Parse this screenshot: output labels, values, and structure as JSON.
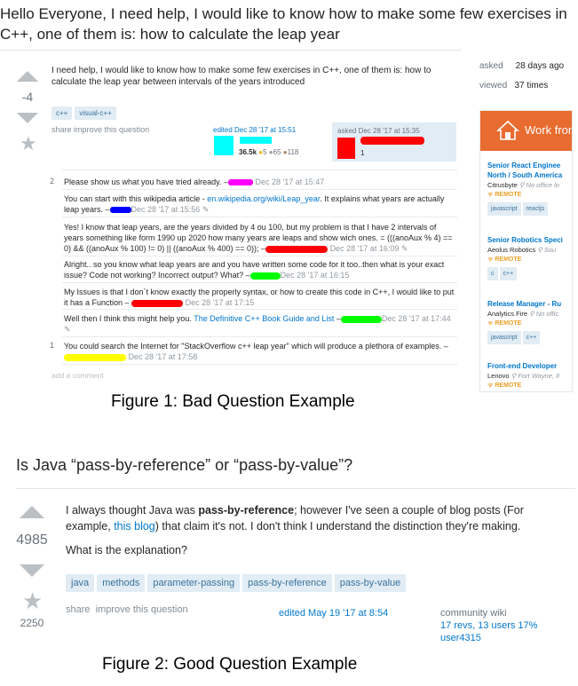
{
  "figure1": {
    "title": "Hello Everyone, I need help, I would like to know how to make some few exercises in C++, one of them is: how to calculate the leap year",
    "score": "-4",
    "body": "I need help, I would like to know how to make some few exercises in C++, one of them is: how to calculate the leap year between intervals of the years introduced",
    "tags": [
      "c++",
      "visual-c++"
    ],
    "share_label": "share",
    "improve_label": "improve this question",
    "edited": "edited Dec 28 '17 at 15:51",
    "editor_rep": "36.5k",
    "editor_badges": [
      "5",
      "65",
      "118"
    ],
    "asked_on": "asked Dec 28 '17 at 15:35",
    "asker_rep": "1",
    "asked_label": "asked",
    "asked_value": "28 days ago",
    "viewed_label": "viewed",
    "viewed_value": "37 times",
    "comments": [
      {
        "votes": "2",
        "text": "Please show us what you have tried already. –",
        "time": "Dec 28 '17 at 15:47"
      },
      {
        "votes": "",
        "text": "You can start with this wikipedia article -",
        "link": "en.wikipedia.org/wiki/Leap_year",
        "text2": ". It explains what years are actually leap years. –",
        "time": "Dec 28 '17 at 15:56"
      },
      {
        "votes": "",
        "text": "Yes! I know that leap years, are the years divided by 4 ou 100, but my problem is that I have 2 intervals of years something like form 1990 up 2020 how many years are leaps and show wich ones. = (((anoAux % 4) == 0) && ((anoAux % 100) != 0) || ((anoAux % 400) == 0)); –",
        "time": "Dec 28 '17 at 16:09"
      },
      {
        "votes": "",
        "text": "Alright.. so you know what leap years are and you have written some code for it too..then what is your exact issue? Code not working? Incorrect output? What? –",
        "time": "Dec 28 '17 at 16:15"
      },
      {
        "votes": "",
        "text": "My Issues is that I don`t know exactly the properly syntax, or how to create this code in C++, I would like to put it has a Function –",
        "time": "Dec 28 '17 at 17:15"
      },
      {
        "votes": "",
        "text": "Well then I think this might help you.",
        "link": "The Definitive C++ Book Guide and List",
        "text2": " –",
        "time": "Dec 28 '17 at 17:44"
      },
      {
        "votes": "1",
        "text": "You could search the Internet for \"StackOverflow c++ leap year\" which will produce a plethora of examples. –",
        "time": "Dec 28 '17 at 17:58"
      }
    ],
    "add_comment": "add a comment",
    "jobs_header": "Work from",
    "jobs": [
      {
        "title1": "Senior React Enginee",
        "title2": "North / South America",
        "company": "Citrusbyte",
        "location": "No office lo",
        "remote": "REMOTE",
        "tags": [
          "javascript",
          "reactjs"
        ]
      },
      {
        "title1": "Senior Robotics Speci",
        "title2": "",
        "company": "Aeolus Robotics",
        "location": "Sou",
        "remote": "REMOTE",
        "tags": [
          "c",
          "c++"
        ]
      },
      {
        "title1": "Release Manager - Ru",
        "title2": "",
        "company": "Analytics Fire",
        "location": "No offic",
        "remote": "REMOTE",
        "tags": [
          "javascript",
          "c++"
        ]
      },
      {
        "title1": "Front-end Developer",
        "title2": "",
        "company": "Lenovo",
        "location": "Fort Wayne, II",
        "remote": "REMOTE",
        "tags": []
      }
    ],
    "caption": "Figure 1: Bad Question Example"
  },
  "figure2": {
    "title": "Is Java “pass-by-reference” or “pass-by-value”?",
    "score": "4985",
    "favorites": "2250",
    "body_pre": "I always thought Java was ",
    "body_bold": "pass-by-reference",
    "body_mid": "; however I've seen a couple of blog posts (For example, ",
    "body_link": "this blog",
    "body_post": ") that claim it's not. I don't think I understand the distinction they're making.",
    "body_q": "What is the explanation?",
    "tags": [
      "java",
      "methods",
      "parameter-passing",
      "pass-by-reference",
      "pass-by-value"
    ],
    "share_label": "share",
    "improve_label": "improve this question",
    "edited": "edited May 19 '17 at 8:54",
    "cw_label": "community wiki",
    "cw_revs": "17 revs, 13 users 17%",
    "cw_user": "user4315",
    "caption": "Figure 2: Good Question Example"
  },
  "colors": {
    "link": "#0077cc",
    "tag_bg": "#e1ecf4",
    "tag_fg": "#39739d",
    "jobs_orange": "#e86b2f",
    "redact_red": "#ff0000",
    "redact_magenta": "#ff00ff",
    "redact_blue": "#0000ff",
    "redact_green": "#00ff00",
    "redact_yellow": "#ffff00",
    "redact_cyan": "#00ffff"
  }
}
